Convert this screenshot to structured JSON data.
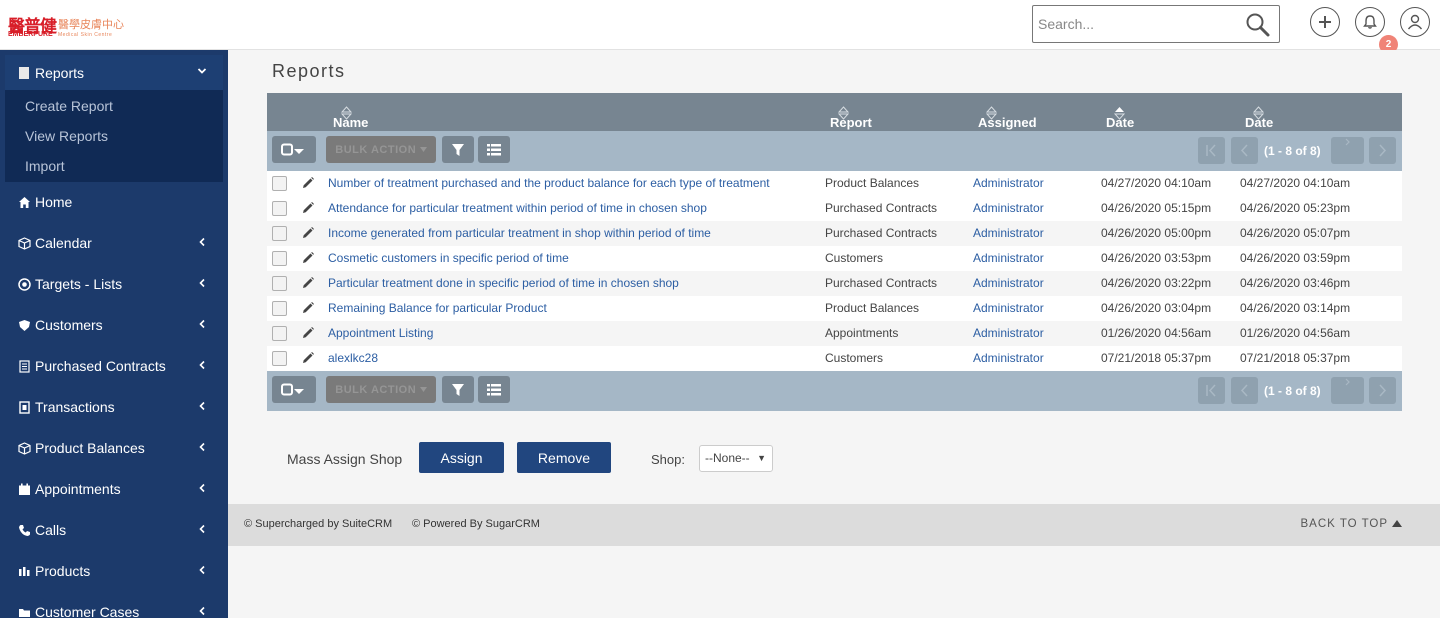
{
  "header": {
    "logo_cn_main": "醫普健",
    "logo_cn_sub": "醫學皮膚中心",
    "logo_en": "EMBERPURE",
    "logo_en_sub": "Medical Skin Centre",
    "search_placeholder": "Search...",
    "notification_count": "2",
    "icons": [
      "search-icon",
      "plus-icon",
      "bell-icon",
      "user-icon"
    ]
  },
  "sidebar": {
    "section": {
      "label": "Reports",
      "sub_items": [
        "Create Report",
        "View Reports",
        "Import"
      ]
    },
    "items": [
      {
        "label": "Home",
        "icon": "home-icon"
      },
      {
        "label": "Calendar",
        "icon": "cube-icon"
      },
      {
        "label": "Targets - Lists",
        "icon": "target-icon"
      },
      {
        "label": "Customers",
        "icon": "shield-icon"
      },
      {
        "label": "Purchased Contracts",
        "icon": "document-icon"
      },
      {
        "label": "Transactions",
        "icon": "receipt-icon"
      },
      {
        "label": "Product Balances",
        "icon": "cube-icon"
      },
      {
        "label": "Appointments",
        "icon": "calendar-icon"
      },
      {
        "label": "Calls",
        "icon": "phone-icon"
      },
      {
        "label": "Products",
        "icon": "bars-icon"
      },
      {
        "label": "Customer Cases",
        "icon": "folder-icon"
      }
    ]
  },
  "main": {
    "title": "Reports",
    "columns": [
      "Name",
      "Report Module",
      "Assigned to",
      "Date Created",
      "Date Modified"
    ],
    "bulk_action": "BULK ACTION",
    "pagination": "(1 - 8 of 8)",
    "rows": [
      {
        "name": "Number of treatment purchased and the product balance for each type of treatment",
        "module": "Product Balances",
        "assigned": "Administrator",
        "created": "04/27/2020 04:10am",
        "modified": "04/27/2020 04:10am"
      },
      {
        "name": "Attendance for particular treatment within period of time in chosen shop",
        "module": "Purchased Contracts",
        "assigned": "Administrator",
        "created": "04/26/2020 05:15pm",
        "modified": "04/26/2020 05:23pm"
      },
      {
        "name": "Income generated from particular treatment in shop within period of time",
        "module": "Purchased Contracts",
        "assigned": "Administrator",
        "created": "04/26/2020 05:00pm",
        "modified": "04/26/2020 05:07pm"
      },
      {
        "name": "Cosmetic customers in specific period of time",
        "module": "Customers",
        "assigned": "Administrator",
        "created": "04/26/2020 03:53pm",
        "modified": "04/26/2020 03:59pm"
      },
      {
        "name": "Particular treatment done in specific period of time in chosen shop",
        "module": "Purchased Contracts",
        "assigned": "Administrator",
        "created": "04/26/2020 03:22pm",
        "modified": "04/26/2020 03:46pm"
      },
      {
        "name": "Remaining Balance for particular Product",
        "module": "Product Balances",
        "assigned": "Administrator",
        "created": "04/26/2020 03:04pm",
        "modified": "04/26/2020 03:14pm"
      },
      {
        "name": "Appointment Listing",
        "module": "Appointments",
        "assigned": "Administrator",
        "created": "01/26/2020 04:56am",
        "modified": "01/26/2020 04:56am"
      },
      {
        "name": "alexlkc28",
        "module": "Customers",
        "assigned": "Administrator",
        "created": "07/21/2018 05:37pm",
        "modified": "07/21/2018 05:37pm"
      }
    ],
    "mass_assign": {
      "label": "Mass Assign Shop",
      "assign": "Assign",
      "remove": "Remove",
      "shop_label": "Shop:",
      "shop_value": "--None--"
    }
  },
  "footer": {
    "supercharged": "© Supercharged by SuiteCRM",
    "powered": "© Powered By SugarCRM",
    "back_to_top": "BACK TO TOP"
  },
  "colors": {
    "sidebar_bg": "#1c3a6b",
    "table_header": "#778591",
    "toolbar": "#a5b7c6",
    "link": "#2c5ea3",
    "button": "#21467f"
  }
}
